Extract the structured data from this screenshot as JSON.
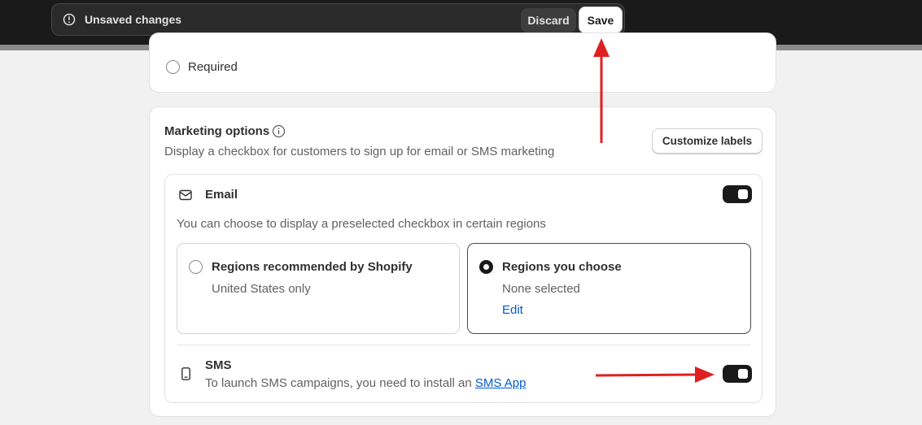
{
  "save_bar": {
    "message": "Unsaved changes",
    "discard_label": "Discard",
    "save_label": "Save"
  },
  "required_option": {
    "label": "Required",
    "selected": false
  },
  "marketing": {
    "title": "Marketing options",
    "description": "Display a checkbox for customers to sign up for email or SMS marketing",
    "customize_label": "Customize labels",
    "email": {
      "title": "Email",
      "enabled": true,
      "description": "You can choose to display a preselected checkbox in certain regions",
      "regions": [
        {
          "title": "Regions recommended by Shopify",
          "subtitle": "United States only",
          "selected": false
        },
        {
          "title": "Regions you choose",
          "subtitle": "None selected",
          "link": "Edit",
          "selected": true
        }
      ]
    },
    "sms": {
      "title": "SMS",
      "enabled": true,
      "description": "To launch SMS campaigns, you need to install an",
      "link": "SMS App"
    }
  },
  "colors": {
    "annotation_arrow": "#e02020",
    "link": "#005bd3",
    "toggle_on": "#1a1a1a"
  },
  "icons": [
    "warning-circle-icon",
    "info-icon",
    "mail-icon",
    "phone-icon"
  ]
}
